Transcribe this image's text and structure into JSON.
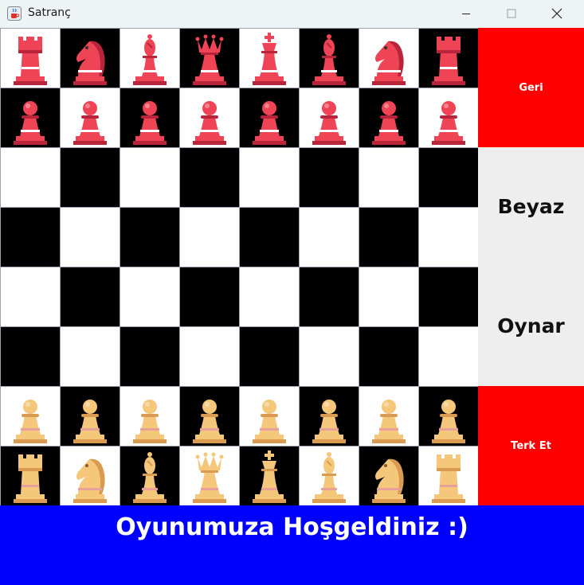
{
  "window": {
    "title": "Satranç",
    "icon": "java-cup-icon"
  },
  "colors": {
    "panel_red": "#ff0000",
    "footer_blue": "#0000ff",
    "red_piece": "#ee4455",
    "gold_piece": "#f4c77a"
  },
  "board": {
    "rows": [
      [
        "red-rook",
        "red-knight",
        "red-bishop",
        "red-queen",
        "red-king",
        "red-bishop",
        "red-knight",
        "red-rook"
      ],
      [
        "red-pawn",
        "red-pawn",
        "red-pawn",
        "red-pawn",
        "red-pawn",
        "red-pawn",
        "red-pawn",
        "red-pawn"
      ],
      [
        "",
        "",
        "",
        "",
        "",
        "",
        "",
        ""
      ],
      [
        "",
        "",
        "",
        "",
        "",
        "",
        "",
        ""
      ],
      [
        "",
        "",
        "",
        "",
        "",
        "",
        "",
        ""
      ],
      [
        "",
        "",
        "",
        "",
        "",
        "",
        "",
        ""
      ],
      [
        "gold-pawn",
        "gold-pawn",
        "gold-pawn",
        "gold-pawn",
        "gold-pawn",
        "gold-pawn",
        "gold-pawn",
        "gold-pawn"
      ],
      [
        "gold-rook",
        "gold-knight",
        "gold-bishop",
        "gold-queen",
        "gold-king",
        "gold-bishop",
        "gold-knight",
        "gold-rook"
      ]
    ]
  },
  "side_panel": {
    "back_label": "Geri",
    "turn_color": "Beyaz",
    "turn_verb": "Oynar",
    "resign_label": "Terk Et"
  },
  "footer": {
    "message": "Oyunumuza Hoşgeldiniz :)"
  }
}
